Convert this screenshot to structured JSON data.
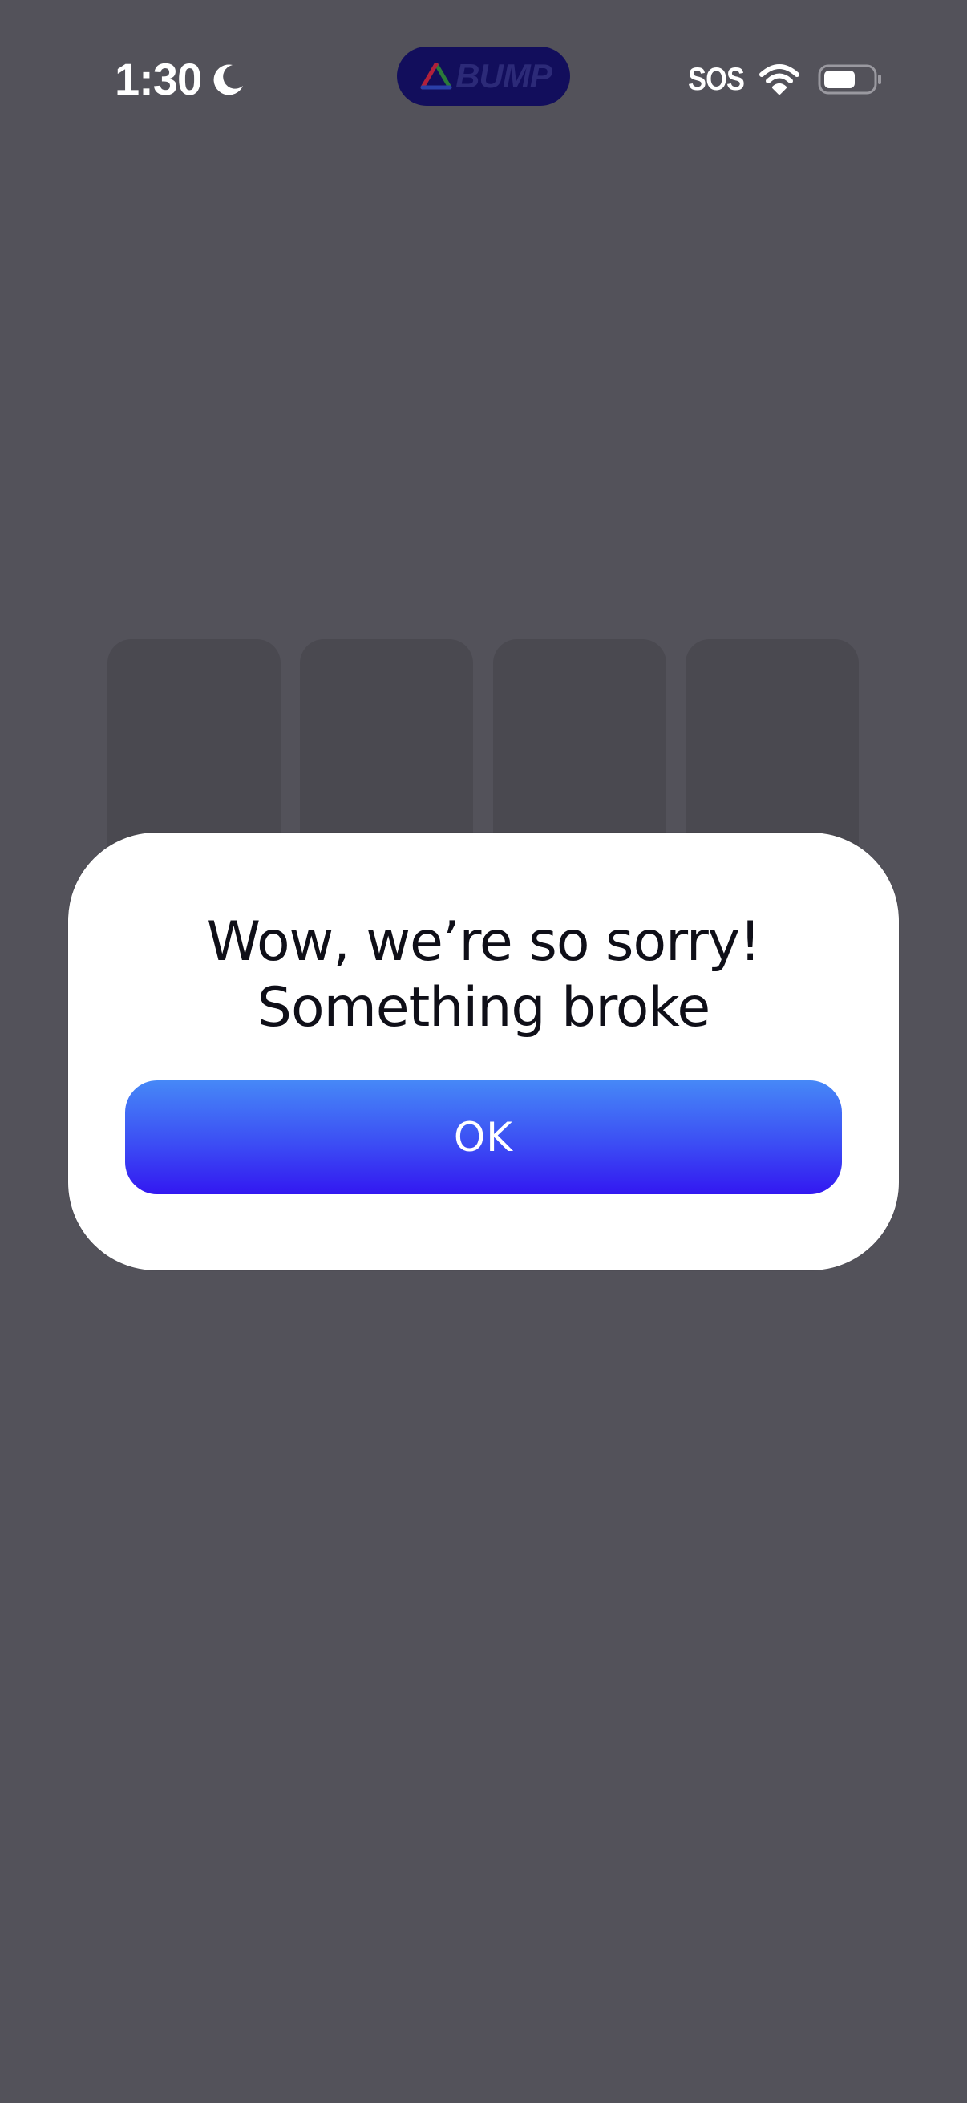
{
  "status_bar": {
    "time": "1:30",
    "focus_icon": "moon-icon",
    "app_badge_text": "BUMP",
    "app_badge_icon": "bump-logo-icon",
    "carrier_status": "SOS",
    "wifi_icon": "wifi-icon",
    "battery_icon": "battery-icon"
  },
  "dialog": {
    "title_line1": "Wow, we’re so sorry!",
    "title_line2": "Something broke",
    "ok_label": "OK"
  },
  "colors": {
    "background": "#53525a",
    "tile": "#4a4950",
    "dialog": "#ffffff",
    "button_top": "#4688f7",
    "button_bottom": "#3318f1",
    "badge": "#120e5c"
  }
}
